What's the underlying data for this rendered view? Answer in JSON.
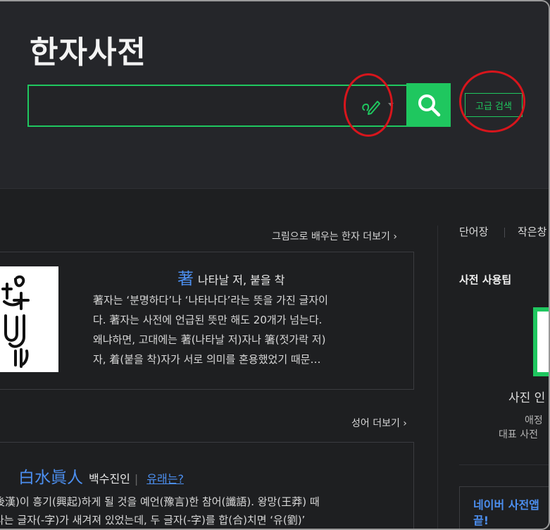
{
  "header": {
    "logo": "한자사전",
    "search": {
      "value": "",
      "placeholder": ""
    },
    "advanced_search_label": "고급 검색"
  },
  "main": {
    "picture_more": "그림으로 배우는 한자 더보기 ›",
    "hanja_card": {
      "character": "著",
      "meaning": "나타날 저, 붙을 착",
      "lines": [
        "著자는 ‘분명하다’나 ‘나타나다’라는 뜻을 가진 글자이",
        "다. 著자는 사전에 언급된 뜻만 해도 20개가 넘는다.",
        "왜냐하면, 고대에는 著(나타날 저)자나 箸(젓가락 저)",
        "자, 着(붙을 착)자가 서로 의미를 혼용했었기 때문…"
      ]
    },
    "idiom_more": "성어 더보기 ›",
    "idiom_card": {
      "characters": "白水眞人",
      "reading": "백수진인",
      "origin_link": "유래는?",
      "lines": [
        "後漢)이 흥기(興起)하게 될 것을 예언(豫言)한 참어(讖語). 왕망(王莽) 때",
        "라는 글자(-字)가 새겨져 있었는데, 두 글자(-字)를 합(合)치면 ‘유(劉)’"
      ]
    }
  },
  "sidebar": {
    "tabs": [
      "단어장",
      "작은창"
    ],
    "tip_title": "사전 사용팁",
    "tip_caption": "사진 인",
    "tip_sub1": "애정",
    "tip_sub2": "대표 사전",
    "naver_line1": "네이버 사전앱",
    "naver_line2": "끝!"
  },
  "colors": {
    "accent": "#1fc75f",
    "link": "#4c8ff0",
    "annotation": "#d8151c",
    "background": "#1e1f21"
  }
}
